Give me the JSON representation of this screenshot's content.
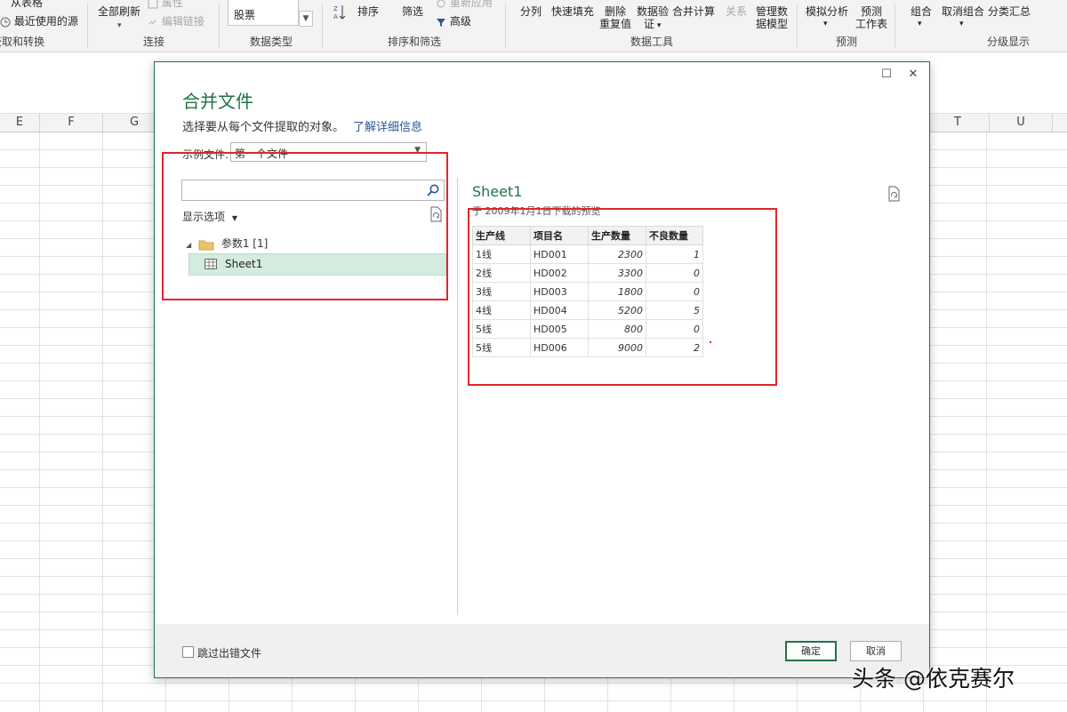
{
  "ribbon": {
    "get_transform": {
      "from_table": "从表格",
      "recent_sources": "最近使用的源",
      "group_label": "获取和转换"
    },
    "connections": {
      "refresh_all": "全部刷新",
      "properties": "属性",
      "edit_links": "编辑链接",
      "group_label": "连接"
    },
    "data_types": {
      "stocks": "股票",
      "group_label": "数据类型"
    },
    "sort_filter": {
      "sort": "排序",
      "filter": "筛选",
      "reapply": "重新应用",
      "advanced": "高级",
      "group_label": "排序和筛选"
    },
    "data_tools": {
      "text_to_columns": "分列",
      "flash_fill": "快速填充",
      "remove_duplicates_1": "删除",
      "remove_duplicates_2": "重复值",
      "data_validation_1": "数据验",
      "data_validation_2": "证",
      "consolidate": "合并计算",
      "relationships": "关系",
      "manage_model_1": "管理数",
      "manage_model_2": "据模型",
      "group_label": "数据工具"
    },
    "forecast": {
      "what_if": "模拟分析",
      "forecast_sheet_1": "预测",
      "forecast_sheet_2": "工作表",
      "group_label": "预测"
    },
    "outline": {
      "group": "组合",
      "ungroup": "取消组合",
      "subtotal": "分类汇总",
      "group_label": "分级显示"
    }
  },
  "sheet": {
    "columns": [
      "E",
      "F",
      "G",
      "T",
      "U"
    ]
  },
  "dialog": {
    "title": "合并文件",
    "description": "选择要从每个文件提取的对象。",
    "learn_more": "了解详细信息",
    "sample_file_label": "示例文件:",
    "sample_file_value": "第一个文件",
    "search_placeholder": "",
    "display_options": "显示选项",
    "tree": {
      "folder_label": "参数1 [1]",
      "item_label": "Sheet1"
    },
    "preview": {
      "title": "Sheet1",
      "subtitle": "于 2009年1月1日下载的预览",
      "headers": [
        "生产线",
        "项目名",
        "生产数量",
        "不良数量"
      ],
      "rows": [
        [
          "1线",
          "HD001",
          "2300",
          "1"
        ],
        [
          "2线",
          "HD002",
          "3300",
          "0"
        ],
        [
          "3线",
          "HD003",
          "1800",
          "0"
        ],
        [
          "4线",
          "HD004",
          "5200",
          "5"
        ],
        [
          "5线",
          "HD005",
          "800",
          "0"
        ],
        [
          "5线",
          "HD006",
          "9000",
          "2"
        ]
      ]
    },
    "footer": {
      "skip_errors_label": "跳过出错文件",
      "skip_errors_checked": false,
      "ok": "确定",
      "cancel": "取消"
    }
  },
  "watermark": "头条 @依克赛尔",
  "colors": {
    "excel_green": "#217346",
    "highlight_red": "#e0262a",
    "selection": "#d3ecdd"
  }
}
